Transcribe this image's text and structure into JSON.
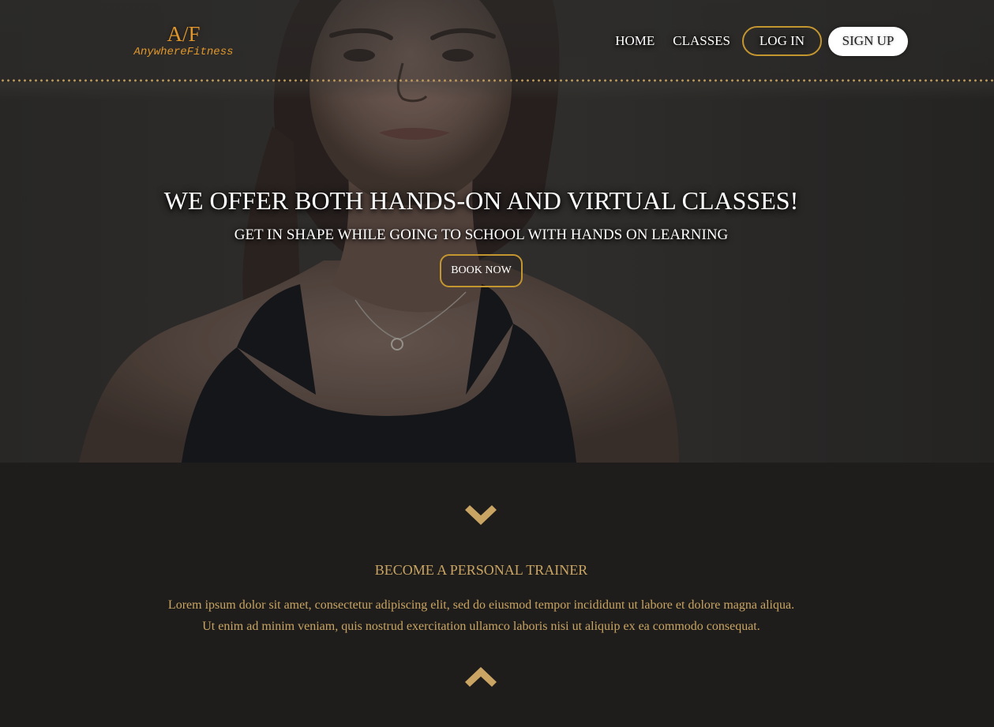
{
  "header": {
    "logo_mark": "A/F",
    "logo_name": "AnywhereFitness",
    "nav": {
      "home": "HOME",
      "classes": "CLASSES",
      "login": "LOG IN",
      "signup": "SIGN UP"
    }
  },
  "hero": {
    "title": "WE OFFER BOTH HANDS-ON AND VIRTUAL CLASSES!",
    "subtitle": "GET IN SHAPE WHILE GOING TO SCHOOL WITH HANDS ON LEARNING",
    "cta": "BOOK NOW"
  },
  "section": {
    "title": "BECOME A PERSONAL TRAINER",
    "body_line1": "Lorem ipsum dolor sit amet, consectetur adipiscing elit, sed do eiusmod tempor incididunt ut labore et dolore magna aliqua.",
    "body_line2": "Ut enim ad minim veniam, quis nostrud exercitation ullamco laboris nisi ut aliquip ex ea commodo consequat.",
    "icons": {
      "down": "chevron-down-icon",
      "up": "chevron-up-icon"
    }
  },
  "colors": {
    "accent_gold": "#c4962f",
    "logo_orange": "#e0962a",
    "text_gold": "#c9a463",
    "background": "#1e1d1b"
  }
}
